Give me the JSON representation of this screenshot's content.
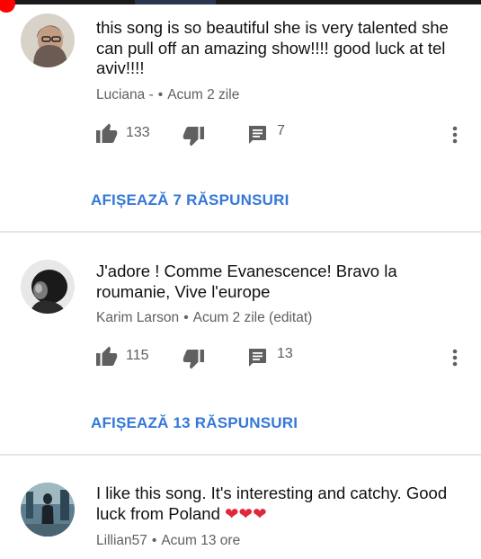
{
  "player": {
    "progress_fraction": 0.01
  },
  "comments": [
    {
      "text": "this song is so beautiful she is very talented she can pull off an amazing show!!!! good luck at tel aviv!!!!",
      "author": "Luciana -",
      "time": "Acum 2 zile",
      "likes": "133",
      "replies_count": "7",
      "replies_link": "AFIȘEAZĂ 7 RĂSPUNSURI"
    },
    {
      "text": "J'adore ! Comme Evanescence! Bravo la roumanie, Vive l'europe",
      "author": "Karim Larson",
      "time": "Acum 2 zile (editat)",
      "likes": "115",
      "replies_count": "13",
      "replies_link": "AFIȘEAZĂ 13 RĂSPUNSURI"
    },
    {
      "text": "I like this song. It's interesting and catchy. Good luck from Poland ❤❤❤",
      "author": "Lillian57",
      "time": "Acum 13 ore"
    }
  ],
  "colors": {
    "accent_link": "#3578d8",
    "progress": "#ff0000",
    "meta_text": "#606060",
    "heart": "#e0283b"
  },
  "icons": [
    "thumbs-up-icon",
    "thumbs-down-icon",
    "reply-icon",
    "more-vert-icon"
  ]
}
